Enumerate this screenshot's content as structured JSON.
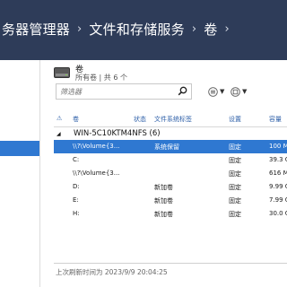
{
  "breadcrumb": {
    "items": [
      "务器管理器",
      "文件和存储服务",
      "卷"
    ],
    "trailing_separator": "›"
  },
  "volumes": {
    "title": "卷",
    "subtitle": "所有卷 | 共 6 个",
    "filter_placeholder": "筛选器"
  },
  "table": {
    "columns": {
      "warning": "⚠",
      "volume": "卷",
      "status": "状态",
      "fs_label": "文件系统标签",
      "setting": "设置",
      "capacity": "容量"
    },
    "group": {
      "toggle": "◢",
      "label": "WIN-5C10KTM4NFS (6)"
    },
    "rows": [
      {
        "volume": "\\\\?\\Volume{3...",
        "status": "",
        "fs_label": "系统保留",
        "setting": "固定",
        "capacity": "100 M",
        "selected": true
      },
      {
        "volume": "C:",
        "status": "",
        "fs_label": "",
        "setting": "固定",
        "capacity": "39.3 G",
        "selected": false
      },
      {
        "volume": "\\\\?\\Volume{3...",
        "status": "",
        "fs_label": "",
        "setting": "固定",
        "capacity": "616 M",
        "selected": false
      },
      {
        "volume": "D:",
        "status": "",
        "fs_label": "新加卷",
        "setting": "固定",
        "capacity": "9.99 G",
        "selected": false
      },
      {
        "volume": "E:",
        "status": "",
        "fs_label": "新加卷",
        "setting": "固定",
        "capacity": "7.99 G",
        "selected": false
      },
      {
        "volume": "H:",
        "status": "",
        "fs_label": "新加卷",
        "setting": "固定",
        "capacity": "30.0 G",
        "selected": false
      }
    ]
  },
  "footer": {
    "last_refreshed": "上次刷新时间为 2023/9/9 20:04:25"
  },
  "colors": {
    "titlebar": "#2e3c59",
    "selection": "#2f78d1",
    "header_text": "#2d5fa8"
  }
}
